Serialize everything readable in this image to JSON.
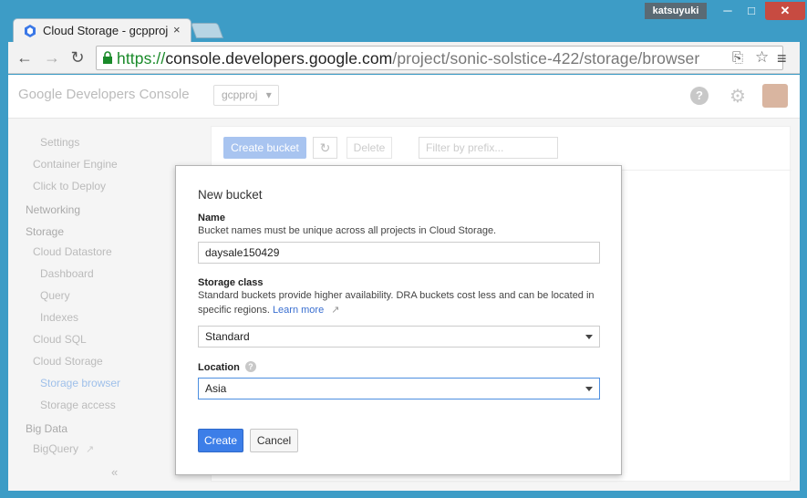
{
  "window": {
    "user": "katsuyuki",
    "min_symbol": "─",
    "max_symbol": "□",
    "close_symbol": "✕"
  },
  "tab": {
    "title": "Cloud Storage - gcpproj",
    "close_symbol": "×"
  },
  "toolbar": {
    "back": "←",
    "forward": "→",
    "reload": "↻",
    "url_scheme": "https://",
    "url_host": "console.developers.google.com",
    "url_path": "/project/sonic-solstice-422/storage/browser",
    "translate_icon": "⎘",
    "star_icon": "☆",
    "menu_icon": "≡"
  },
  "header": {
    "logo": "Google Developers Console",
    "project": "gcpproj",
    "project_caret": "▾",
    "feedback_icon": "?",
    "settings_icon": "⚙"
  },
  "sidebar": {
    "items": [
      {
        "label": "Settings"
      },
      {
        "label": "Container Engine"
      },
      {
        "label": "Click to Deploy"
      },
      {
        "label": "Networking"
      },
      {
        "label": "Storage"
      },
      {
        "label": "Cloud Datastore"
      },
      {
        "label": "Dashboard"
      },
      {
        "label": "Query"
      },
      {
        "label": "Indexes"
      },
      {
        "label": "Cloud SQL"
      },
      {
        "label": "Cloud Storage"
      },
      {
        "label": "Storage browser"
      },
      {
        "label": "Storage access"
      },
      {
        "label": "Big Data"
      },
      {
        "label": "BigQuery"
      }
    ],
    "collapse": "«"
  },
  "content": {
    "create_bucket": "Create bucket",
    "refresh": "↻",
    "delete": "Delete",
    "filter_placeholder": "Filter by prefix..."
  },
  "dialog": {
    "title": "New bucket",
    "name_label": "Name",
    "name_help": "Bucket names must be unique across all projects in Cloud Storage.",
    "name_value": "daysale150429",
    "storage_label": "Storage class",
    "storage_help": "Standard buckets provide higher availability. DRA buckets cost less and can be located in specific regions.",
    "learn_more": "Learn more",
    "ext_icon": "↗",
    "storage_value": "Standard",
    "location_label": "Location",
    "location_help_icon": "?",
    "location_value": "Asia",
    "create": "Create",
    "cancel": "Cancel"
  },
  "colors": {
    "window_frame": "#3d9cc6",
    "close_button": "#c74b41",
    "primary_button": "#3c7ee8",
    "link": "#3a6fd0",
    "url_scheme": "#1a8a2a"
  }
}
